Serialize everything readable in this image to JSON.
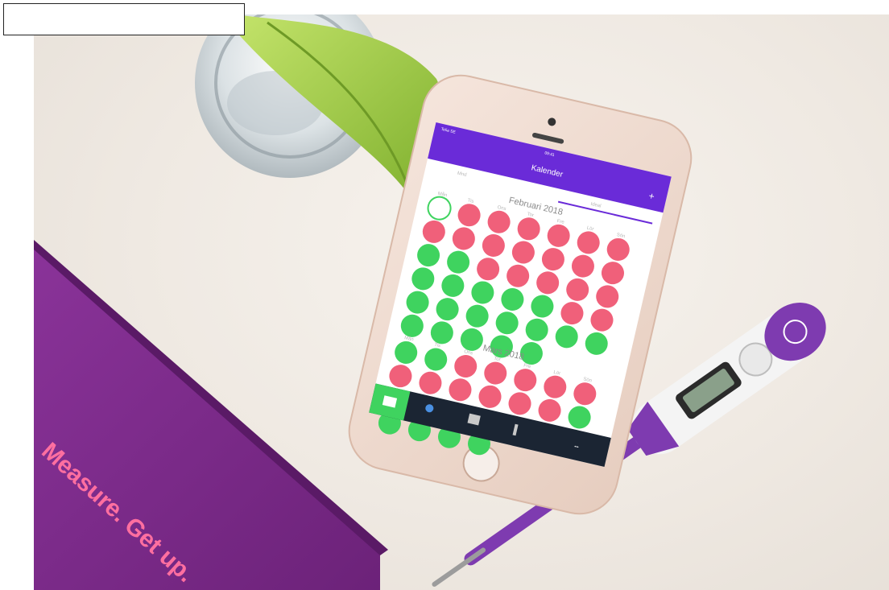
{
  "box_text": "Measure. Get up.",
  "phone": {
    "status": {
      "carrier": "Telia SE",
      "time": "09:41"
    },
    "app_title": "Kalender",
    "tabs": [
      "Mnd",
      "Ideal"
    ],
    "months": [
      {
        "label": "Februari 2018",
        "weekdays": [
          "Mån",
          "Tis",
          "Ons",
          "Tor",
          "Fre",
          "Lör",
          "Sön"
        ],
        "pattern": "WRRRRRRRRRRRRRGGRRRRRGGGGGRRGGGGGGGGGGGG"
      },
      {
        "label": "Mars 2018",
        "weekdays": [
          "Mån",
          "Tis",
          "Ons",
          "Tor",
          "Fre",
          "Lör",
          "Sön"
        ],
        "pattern": "GGRRRRRRRRRRRGGRRRRRGGGGG"
      }
    ]
  },
  "colors": {
    "period_red": "#f0607a",
    "green_day": "#3fd35f",
    "app_purple": "#6a2bd8",
    "box_purple": "#7a2a86",
    "thermometer_purple": "#7e3bb0"
  }
}
